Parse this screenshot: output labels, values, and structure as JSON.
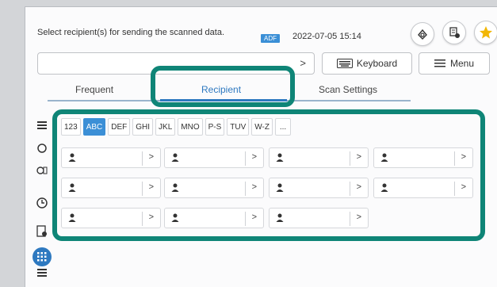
{
  "header": {
    "instruction": "Select recipient(s) for sending the scanned data.",
    "adf_badge": "ADF",
    "datetime": "2022-07-05 15:14"
  },
  "top_icons": [
    {
      "name": "send-history-icon"
    },
    {
      "name": "job-status-icon"
    },
    {
      "name": "favorite-star-icon",
      "color": "#f2b705"
    }
  ],
  "address_bar": {
    "value": "",
    "arrow": ">"
  },
  "keyboard_button": {
    "label": "Keyboard"
  },
  "menu_button": {
    "label": "Menu"
  },
  "tabs": [
    {
      "label": "Frequent",
      "active": false
    },
    {
      "label": "Recipient",
      "active": true
    },
    {
      "label": "Scan Settings",
      "active": false
    }
  ],
  "letter_tabs": [
    {
      "label": "123",
      "active": false
    },
    {
      "label": "ABC",
      "active": true
    },
    {
      "label": "DEF",
      "active": false
    },
    {
      "label": "GHI",
      "active": false
    },
    {
      "label": "JKL",
      "active": false
    },
    {
      "label": "MNO",
      "active": false
    },
    {
      "label": "P-S",
      "active": false
    },
    {
      "label": "TUV",
      "active": false
    },
    {
      "label": "W-Z",
      "active": false
    },
    {
      "label": "...",
      "active": false
    }
  ],
  "recipient_rows": [
    [
      ">",
      ">",
      ">",
      ">"
    ],
    [
      ">",
      ">",
      ">",
      ">"
    ],
    [
      ">",
      ">",
      ">"
    ]
  ],
  "side_icons": [
    {
      "name": "list-view-icon",
      "glyph": "≡"
    },
    {
      "name": "search-icon",
      "glyph": "◯"
    },
    {
      "name": "address-book-search-icon",
      "glyph": "⊕"
    },
    {
      "name": "history-icon",
      "glyph": "◷"
    },
    {
      "name": "contact-detail-icon",
      "glyph": "▣"
    },
    {
      "name": "grid-view-icon",
      "glyph": "⁝⁝",
      "active": true
    },
    {
      "name": "list-toggle-icon",
      "glyph": "☰"
    }
  ],
  "colors": {
    "accent": "#2e79c0",
    "highlight": "#0f8577",
    "badge": "#3b8fd6"
  }
}
